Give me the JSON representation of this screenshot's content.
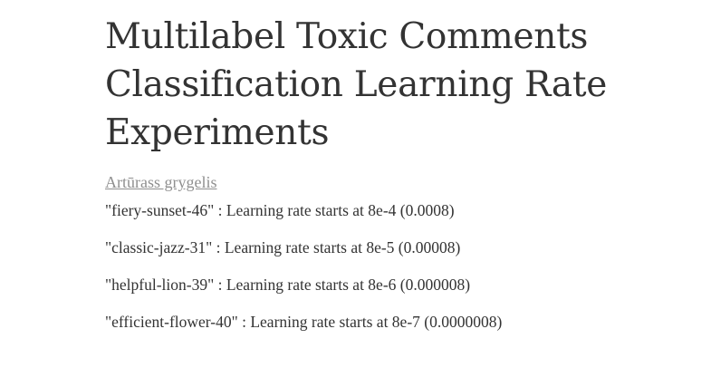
{
  "report": {
    "title": "Multilabel Toxic Comments Classification Learning Rate Experiments",
    "author": "Artūrass grygelis",
    "runs": [
      "\"fiery-sunset-46\" : Learning rate starts at 8e-4 (0.0008)",
      "\"classic-jazz-31\" : Learning rate starts at 8e-5 (0.00008)",
      "\"helpful-lion-39\" : Learning rate starts at 8e-6 (0.000008)",
      "\"efficient-flower-40\" : Learning rate starts at 8e-7 (0.0000008)"
    ]
  }
}
